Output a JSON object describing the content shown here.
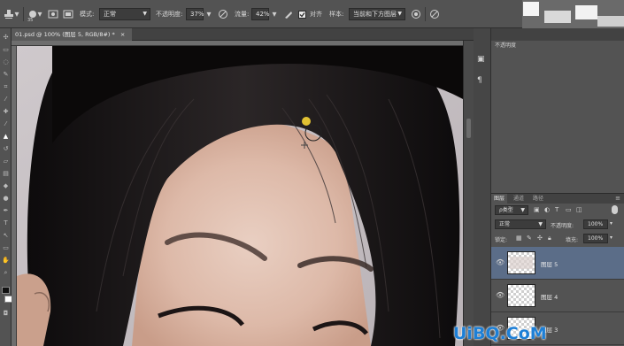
{
  "options_bar": {
    "brush_size": "35",
    "mode_label": "模式:",
    "mode_value": "正常",
    "opacity_label": "不透明度:",
    "opacity_value": "37%",
    "flow_label": "流量:",
    "flow_value": "42%",
    "align_label": "对齐",
    "sample_label": "样本:",
    "sample_value": "当前和下方图层"
  },
  "document": {
    "tab_title": "01.psd @ 100% (图层 5, RGB/8#) *"
  },
  "history_panel": {
    "label": "不透明度"
  },
  "layers_panel": {
    "tabs": [
      "图层",
      "通道",
      "路径"
    ],
    "filter_kind": "ρ类型",
    "blend_mode": "正常",
    "opacity_label": "不透明度:",
    "opacity_value": "100%",
    "lock_label": "锁定:",
    "fill_label": "填充:",
    "fill_value": "100%",
    "layers": [
      {
        "name": "图层 5",
        "selected": true
      },
      {
        "name": "图层 4",
        "selected": false
      },
      {
        "name": "图层 3",
        "selected": false
      }
    ]
  },
  "watermark": {
    "text": "UiBQ.CoM",
    "color": "#1d7fd6"
  },
  "colors": {
    "selection": "#5b6d88",
    "panel_bg": "#535353",
    "brush_dot": "#e2c233"
  }
}
